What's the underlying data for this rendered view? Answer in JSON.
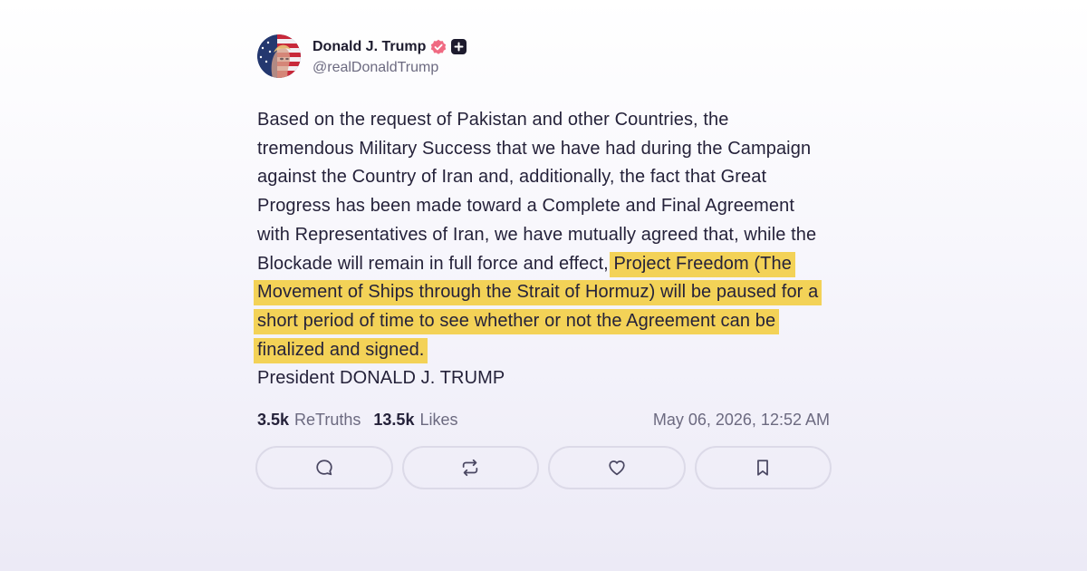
{
  "author": {
    "name": "Donald J. Trump",
    "handle": "@realDonaldTrump",
    "verified_badge_icon": "verified-badge-icon",
    "plus_icon": "plus-square-icon"
  },
  "post": {
    "text_before": "Based on the request of Pakistan and other Countries, the tremendous Military Success that we have had during the Campaign against the Country of Iran and, additionally, the fact that Great Progress has been made toward a Complete and Final Agreement with Representatives of Iran, we have mutually agreed that, while the Blockade will remain in full force and effect,",
    "text_highlighted": "Project Freedom (The Movement of Ships through the Strait of Hormuz) will be paused for a short period of time to see whether or not the Agreement can be finalized and signed.",
    "signature": "President DONALD J. TRUMP",
    "highlight_color": "#f3d257"
  },
  "stats": {
    "retruths_count": "3.5k",
    "retruths_label": "ReTruths",
    "likes_count": "13.5k",
    "likes_label": "Likes",
    "timestamp": "May 06, 2026, 12:52 AM"
  },
  "actions": [
    {
      "icon": "reply-icon"
    },
    {
      "icon": "retruth-icon"
    },
    {
      "icon": "heart-icon"
    },
    {
      "icon": "bookmark-icon"
    }
  ]
}
